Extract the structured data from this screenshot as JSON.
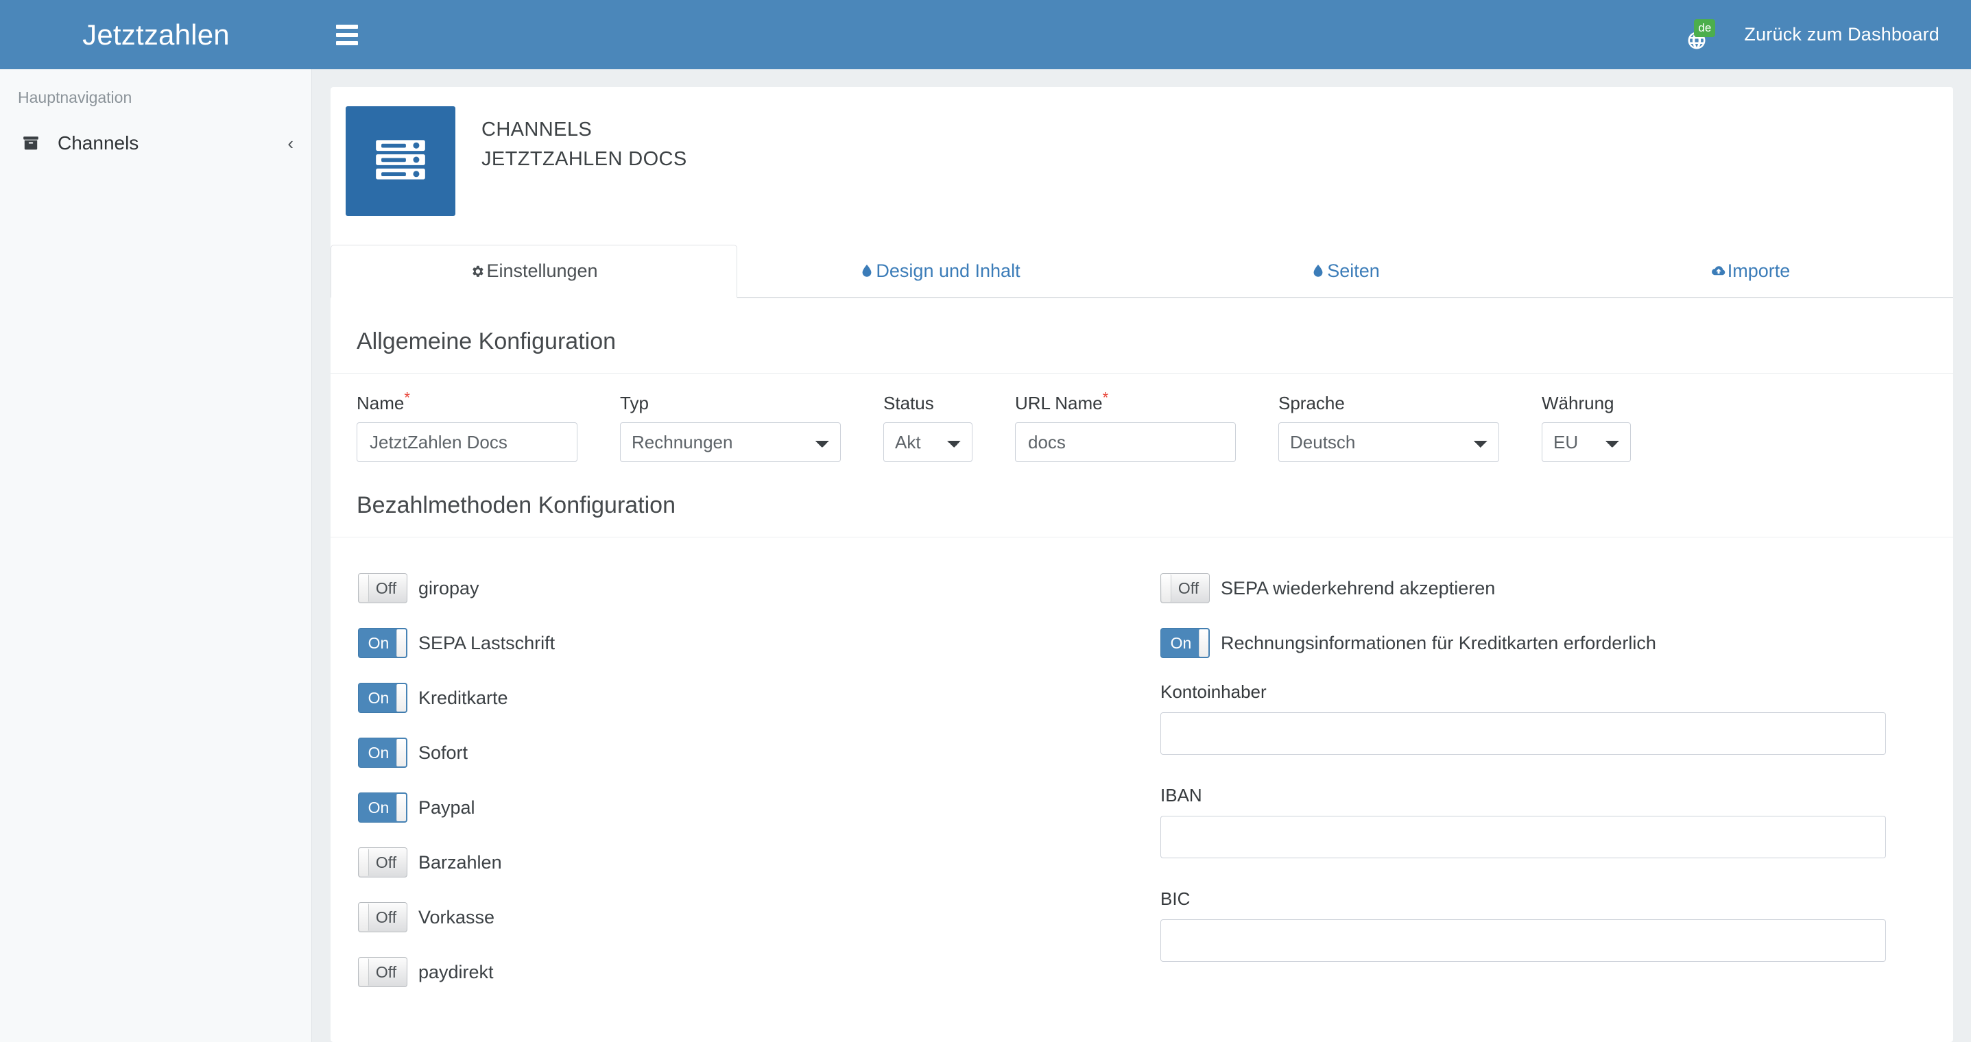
{
  "header": {
    "brand": "Jetztzahlen",
    "menu_icon": "hamburger-icon",
    "language_badge": "de",
    "language_icon": "globe-icon",
    "dashboard_link": "Zurück zum Dashboard"
  },
  "sidebar": {
    "nav_title": "Hauptnavigation",
    "items": [
      {
        "label": "Channels",
        "icon": "archive-box-icon",
        "caret": "‹"
      }
    ]
  },
  "channel": {
    "thumb_icon": "server-rack-icon",
    "breadcrumb": "CHANNELS",
    "title": "JETZTZAHLEN DOCS"
  },
  "tabs": [
    {
      "label": "Einstellungen",
      "icon": "gear-icon",
      "active": true
    },
    {
      "label": "Design und Inhalt",
      "icon": "droplet-icon",
      "active": false
    },
    {
      "label": "Seiten",
      "icon": "droplet-icon",
      "active": false
    },
    {
      "label": "Importe",
      "icon": "cloud-upload-icon",
      "active": false
    }
  ],
  "general": {
    "section_title": "Allgemeine Konfiguration",
    "fields": {
      "name": {
        "label": "Name",
        "required": true,
        "value": "JetztZahlen Docs"
      },
      "typ": {
        "label": "Typ",
        "required": false,
        "value": "Rechnungen"
      },
      "status": {
        "label": "Status",
        "required": false,
        "value": "Akt"
      },
      "url_name": {
        "label": "URL Name",
        "required": true,
        "value": "docs"
      },
      "sprache": {
        "label": "Sprache",
        "required": false,
        "value": "Deutsch"
      },
      "waehrung": {
        "label": "Währung",
        "required": false,
        "value": "EU"
      }
    }
  },
  "payment": {
    "section_title": "Bezahlmethoden Konfiguration",
    "left_toggles": [
      {
        "label": "giropay",
        "state": "Off",
        "on": false
      },
      {
        "label": "SEPA Lastschrift",
        "state": "On",
        "on": true
      },
      {
        "label": "Kreditkarte",
        "state": "On",
        "on": true
      },
      {
        "label": "Sofort",
        "state": "On",
        "on": true
      },
      {
        "label": "Paypal",
        "state": "On",
        "on": true
      },
      {
        "label": "Barzahlen",
        "state": "Off",
        "on": false
      },
      {
        "label": "Vorkasse",
        "state": "Off",
        "on": false
      },
      {
        "label": "paydirekt",
        "state": "Off",
        "on": false
      }
    ],
    "right_toggles": [
      {
        "label": "SEPA wiederkehrend akzeptieren",
        "state": "Off",
        "on": false
      },
      {
        "label": "Rechnungsinformationen für Kreditkarten erforderlich",
        "state": "On",
        "on": true
      }
    ],
    "bank_fields": [
      {
        "label": "Kontoinhaber",
        "value": ""
      },
      {
        "label": "IBAN",
        "value": ""
      },
      {
        "label": "BIC",
        "value": ""
      }
    ]
  },
  "colors": {
    "brand_blue": "#4b87ba",
    "thumb_blue": "#2c6ca8",
    "link_blue": "#3b7cb8",
    "badge_green": "#4cae4c",
    "required_red": "#e8483c",
    "sidebar_bg": "#f7f9fa",
    "content_bg": "#eceff1"
  }
}
